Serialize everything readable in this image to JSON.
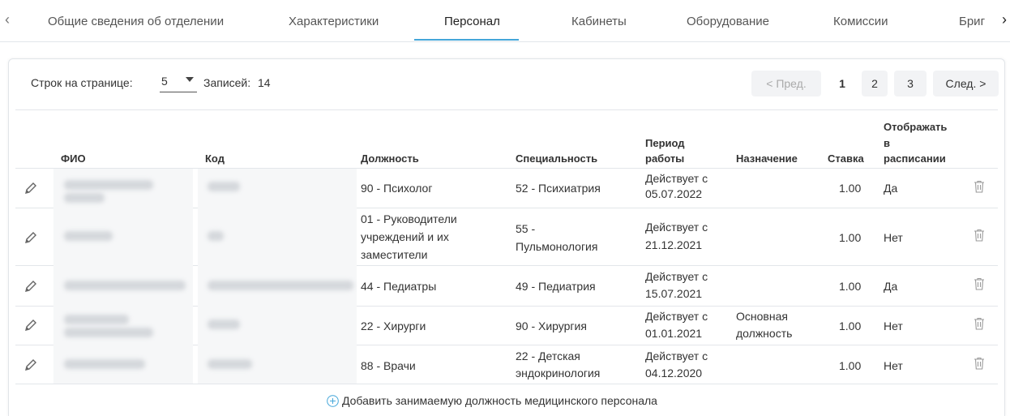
{
  "tabs": {
    "items": [
      "Общие сведения об отделении",
      "Характеристики",
      "Персонал",
      "Кабинеты",
      "Оборудование",
      "Комиссии",
      "Бриг"
    ],
    "active": "Персонал",
    "prev_icon": "chevron-left-icon",
    "next_icon": "chevron-right-icon"
  },
  "toolbar": {
    "rows_label": "Строк на странице:",
    "rows_value": "5",
    "records_label": "Записей:",
    "records_count": "14"
  },
  "pagination": {
    "prev": "< Пред.",
    "pages": [
      "1",
      "2",
      "3"
    ],
    "current": "1",
    "next": "След. >"
  },
  "table": {
    "headers": {
      "fio": "ФИО",
      "code": "Код",
      "position": "Должность",
      "specialty": "Специальность",
      "period_1": "Период",
      "period_2": "работы",
      "assignment": "Назначение",
      "rate": "Ставка",
      "show_1": "Отображать",
      "show_2": "в",
      "show_3": "расписании"
    },
    "rows": [
      {
        "position": [
          "90 - Психолог"
        ],
        "specialty": [
          "52 - Психиатрия"
        ],
        "period": [
          "Действует с",
          "05.07.2022"
        ],
        "assignment": [],
        "rate": "1.00",
        "show": "Да"
      },
      {
        "position": [
          "01 - Руководители",
          "учреждений и их",
          "заместители"
        ],
        "specialty": [
          "55 -",
          "Пульмонология"
        ],
        "period": [
          "Действует с",
          "21.12.2021"
        ],
        "assignment": [],
        "rate": "1.00",
        "show": "Нет"
      },
      {
        "position": [
          "44 - Педиатры"
        ],
        "specialty": [
          "49 - Педиатрия"
        ],
        "period": [
          "Действует с",
          "15.07.2021"
        ],
        "assignment": [],
        "rate": "1.00",
        "show": "Да"
      },
      {
        "position": [
          "22 - Хирурги"
        ],
        "specialty": [
          "90 - Хирургия"
        ],
        "period": [
          "Действует с",
          "01.01.2021"
        ],
        "assignment": [
          "Основная",
          "должность"
        ],
        "rate": "1.00",
        "show": "Нет"
      },
      {
        "position": [
          "88 - Врачи"
        ],
        "specialty": [
          "22 - Детская",
          "эндокринология"
        ],
        "period": [
          "Действует с",
          "04.12.2020"
        ],
        "assignment": [],
        "rate": "1.00",
        "show": "Нет"
      }
    ]
  },
  "add_button": {
    "label": "Добавить занимаемую должность медицинского персонала",
    "icon": "plus-circle-icon"
  },
  "colors": {
    "accent": "#44a6d9",
    "icon_gray": "#9a9a9a"
  }
}
